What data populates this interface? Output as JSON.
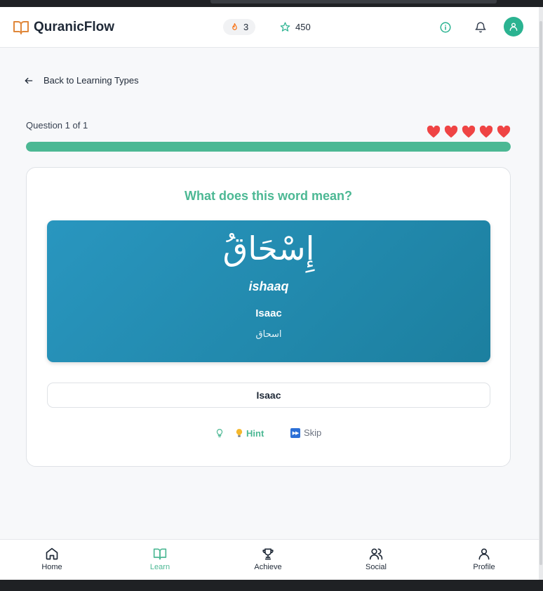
{
  "app": {
    "title": "QuranicFlow"
  },
  "header": {
    "streak": "3",
    "points": "450"
  },
  "back_link": {
    "label": "Back to Learning Types"
  },
  "quiz": {
    "question_count": "Question 1 of 1",
    "lives": 5,
    "progress": 1.0,
    "prompt": "What does this word mean?",
    "word": {
      "arabic": "إِسْحَاقُ",
      "transliteration": "ishaaq",
      "meaning": "Isaac",
      "arabic_plain": "اسحاق"
    },
    "answer": "Isaac",
    "hint_label": "Hint",
    "skip_label": "Skip"
  },
  "nav": {
    "items": [
      {
        "label": "Home",
        "icon": "home-icon",
        "active": false
      },
      {
        "label": "Learn",
        "icon": "book-icon",
        "active": true
      },
      {
        "label": "Achieve",
        "icon": "trophy-icon",
        "active": false
      },
      {
        "label": "Social",
        "icon": "users-icon",
        "active": false
      },
      {
        "label": "Profile",
        "icon": "user-icon",
        "active": false
      }
    ]
  },
  "colors": {
    "accent": "#4cb894",
    "streak": "#f97316",
    "heart": "#ef4444",
    "word_card": "#2996bf"
  }
}
